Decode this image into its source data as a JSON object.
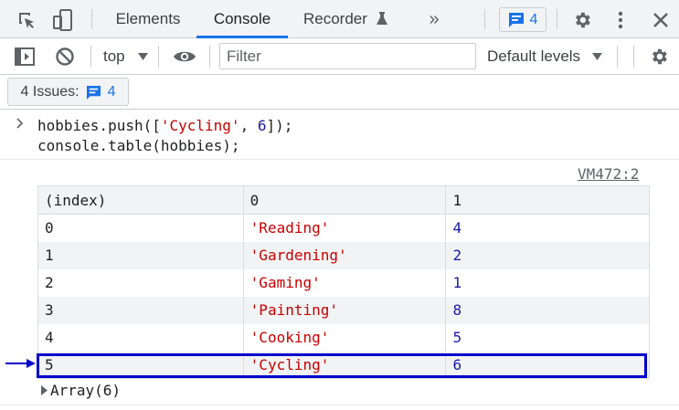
{
  "devtools": {
    "tabs": [
      {
        "label": "Elements"
      },
      {
        "label": "Console"
      },
      {
        "label": "Recorder"
      }
    ],
    "more_tabs_glyph": "»",
    "issues_badge_count": "4",
    "icons": [
      "inspect-icon",
      "device-toggle-icon",
      "flask-icon",
      "message-icon",
      "gear-icon",
      "kebab-menu-icon",
      "close-icon",
      "sidebar-icon",
      "clear-icon",
      "eye-icon",
      "dropdown-arrow-icon"
    ]
  },
  "toolbar": {
    "context": "top",
    "filter_placeholder": "Filter",
    "levels": "Default levels"
  },
  "issues": {
    "label": "4 Issues:",
    "count": "4"
  },
  "console": {
    "input": {
      "line1": {
        "a": "hobbies.push([",
        "b": "'Cycling'",
        "c": ", ",
        "d": "6",
        "e": "]);"
      },
      "line2": "console.table(hobbies);"
    },
    "source": "VM472:2",
    "table": {
      "headers": [
        "(index)",
        "0",
        "1"
      ],
      "rows": [
        {
          "index": "0",
          "name": "'Reading'",
          "value": "4"
        },
        {
          "index": "1",
          "name": "'Gardening'",
          "value": "2"
        },
        {
          "index": "2",
          "name": "'Gaming'",
          "value": "1"
        },
        {
          "index": "3",
          "name": "'Painting'",
          "value": "8"
        },
        {
          "index": "4",
          "name": "'Cooking'",
          "value": "5"
        },
        {
          "index": "5",
          "name": "'Cycling'",
          "value": "6"
        }
      ]
    },
    "array_summary": "Array(6)",
    "highlight_color": "#0000cc"
  }
}
